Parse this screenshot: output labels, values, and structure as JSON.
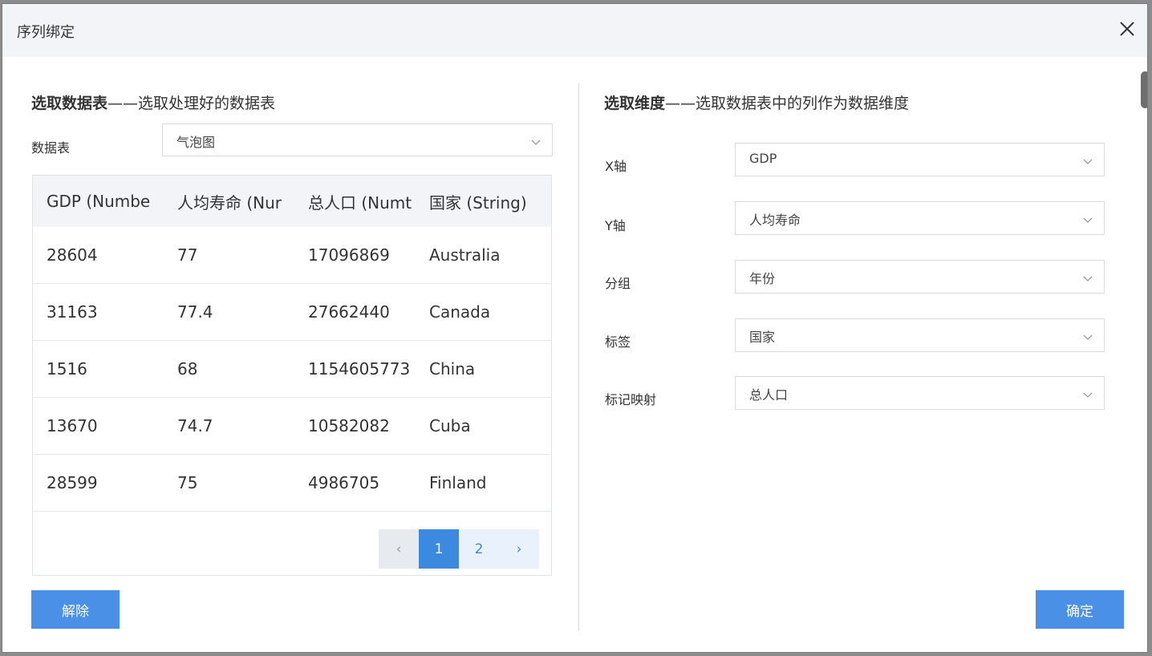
{
  "dialog": {
    "title": "序列绑定"
  },
  "left": {
    "heading_bold": "选取数据表",
    "heading_rest": "——选取处理好的数据表",
    "table_label": "数据表",
    "table_select": "气泡图",
    "columns": [
      "GDP (Numbe",
      "人均寿命 (Nur",
      "总人口 (Numt",
      "国家 (String)"
    ],
    "rows": [
      [
        "28604",
        "77",
        "17096869",
        "Australia"
      ],
      [
        "31163",
        "77.4",
        "27662440",
        "Canada"
      ],
      [
        "1516",
        "68",
        "1154605773",
        "China"
      ],
      [
        "13670",
        "74.7",
        "10582082",
        "Cuba"
      ],
      [
        "28599",
        "75",
        "4986705",
        "Finland"
      ]
    ],
    "pager": {
      "prev": "‹",
      "pages": [
        "1",
        "2"
      ],
      "current": "1",
      "next": "›"
    },
    "unbind_button": "解除"
  },
  "right": {
    "heading_bold": "选取维度",
    "heading_rest": "——选取数据表中的列作为数据维度",
    "fields": [
      {
        "label": "X轴",
        "value": "GDP"
      },
      {
        "label": "Y轴",
        "value": "人均寿命"
      },
      {
        "label": "分组",
        "value": "年份"
      },
      {
        "label": "标签",
        "value": "国家"
      },
      {
        "label": "标记映射",
        "value": "总人口"
      }
    ],
    "confirm_button": "确定"
  },
  "colors": {
    "accent": "#4a90e6",
    "header_bg": "#f2f4f7"
  }
}
